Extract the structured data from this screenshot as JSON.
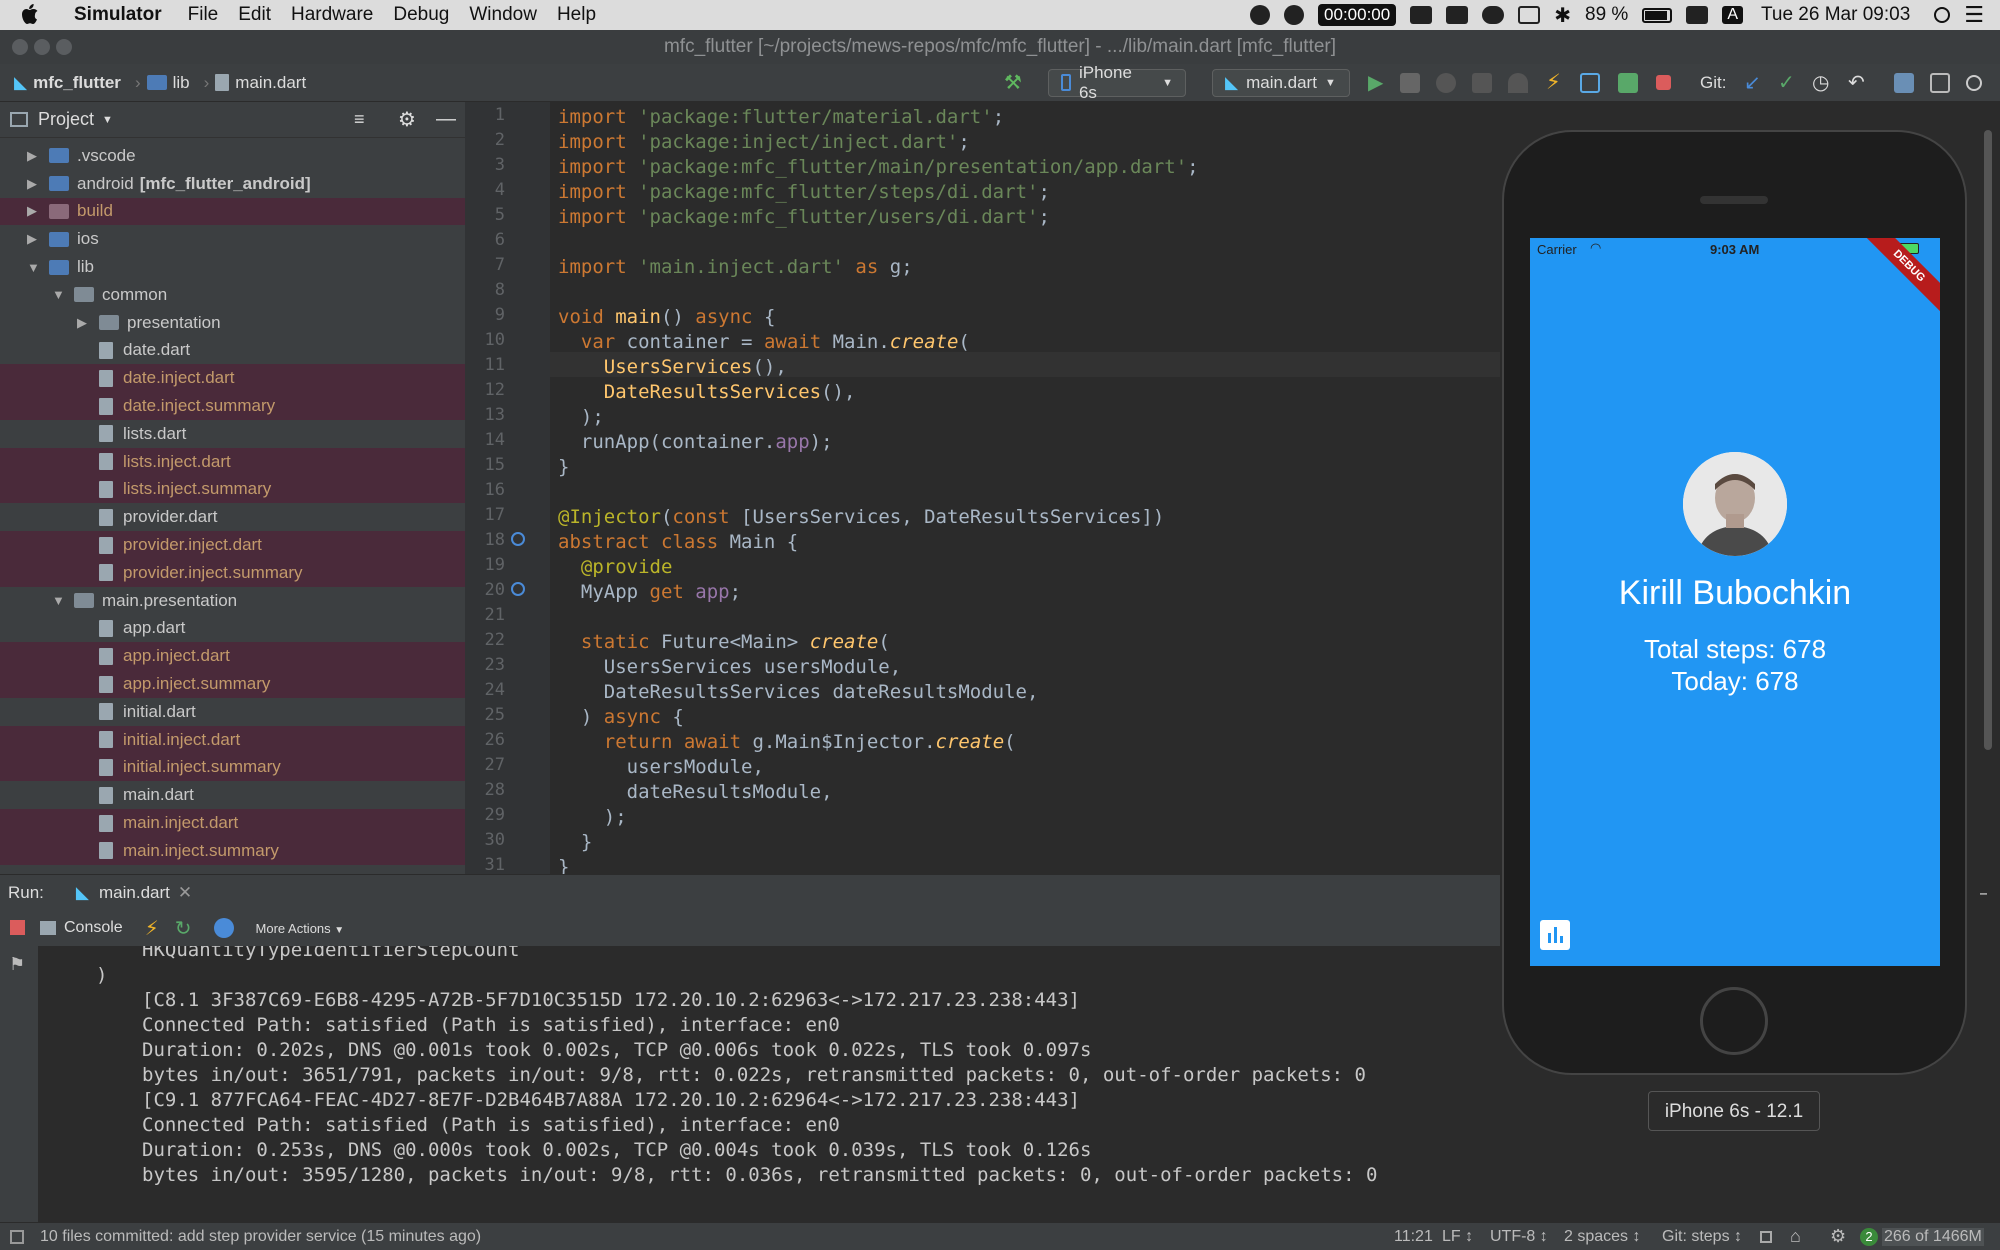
{
  "menubar": {
    "app": "Simulator",
    "items": [
      "File",
      "Edit",
      "Hardware",
      "Debug",
      "Window",
      "Help"
    ],
    "recording": "00:00:00",
    "battery": "89 %",
    "input": "A",
    "datetime": "Tue 26 Mar  09:03"
  },
  "window": {
    "title": "mfc_flutter [~/projects/mews-repos/mfc/mfc_flutter] - .../lib/main.dart [mfc_flutter]"
  },
  "navbar": {
    "crumbs": [
      "mfc_flutter",
      "lib",
      "main.dart"
    ],
    "device": "iPhone 6s",
    "run_config": "main.dart",
    "git_label": "Git:"
  },
  "project": {
    "title": "Project",
    "tree": [
      {
        "label": ".vscode",
        "type": "folder",
        "indent": 1,
        "arrow": "right",
        "ignored": false
      },
      {
        "label": "android",
        "tag": "[mfc_flutter_android]",
        "type": "folder",
        "indent": 1,
        "arrow": "right",
        "ignored": false
      },
      {
        "label": "build",
        "type": "folder",
        "indent": 1,
        "arrow": "right",
        "ignored": true
      },
      {
        "label": "ios",
        "type": "folder",
        "indent": 1,
        "arrow": "right",
        "ignored": false
      },
      {
        "label": "lib",
        "type": "folder",
        "indent": 1,
        "arrow": "down",
        "ignored": false
      },
      {
        "label": "common",
        "type": "folder",
        "indent": 2,
        "arrow": "down",
        "ignored": false
      },
      {
        "label": "presentation",
        "type": "folder",
        "indent": 3,
        "arrow": "right",
        "ignored": false
      },
      {
        "label": "date.dart",
        "type": "file",
        "indent": 3,
        "ignored": false
      },
      {
        "label": "date.inject.dart",
        "type": "file",
        "indent": 3,
        "ignored": true
      },
      {
        "label": "date.inject.summary",
        "type": "file",
        "indent": 3,
        "ignored": true
      },
      {
        "label": "lists.dart",
        "type": "file",
        "indent": 3,
        "ignored": false
      },
      {
        "label": "lists.inject.dart",
        "type": "file",
        "indent": 3,
        "ignored": true
      },
      {
        "label": "lists.inject.summary",
        "type": "file",
        "indent": 3,
        "ignored": true
      },
      {
        "label": "provider.dart",
        "type": "file",
        "indent": 3,
        "ignored": false
      },
      {
        "label": "provider.inject.dart",
        "type": "file",
        "indent": 3,
        "ignored": true
      },
      {
        "label": "provider.inject.summary",
        "type": "file",
        "indent": 3,
        "ignored": true
      },
      {
        "label": "main.presentation",
        "type": "folder",
        "indent": 2,
        "arrow": "down",
        "ignored": false
      },
      {
        "label": "app.dart",
        "type": "file",
        "indent": 3,
        "ignored": false
      },
      {
        "label": "app.inject.dart",
        "type": "file",
        "indent": 3,
        "ignored": true
      },
      {
        "label": "app.inject.summary",
        "type": "file",
        "indent": 3,
        "ignored": true
      },
      {
        "label": "initial.dart",
        "type": "file",
        "indent": 3,
        "ignored": false
      },
      {
        "label": "initial.inject.dart",
        "type": "file",
        "indent": 3,
        "ignored": true
      },
      {
        "label": "initial.inject.summary",
        "type": "file",
        "indent": 3,
        "ignored": true
      },
      {
        "label": "main.dart",
        "type": "file",
        "indent": 3,
        "ignored": false
      },
      {
        "label": "main.inject.dart",
        "type": "file",
        "indent": 3,
        "ignored": true
      },
      {
        "label": "main.inject.summary",
        "type": "file",
        "indent": 3,
        "ignored": true
      }
    ]
  },
  "editor": {
    "lines": [
      [
        [
          "kw",
          "import "
        ],
        [
          "str",
          "'package:flutter/material.dart'"
        ],
        [
          "",
          "; "
        ]
      ],
      [
        [
          "kw",
          "import "
        ],
        [
          "str",
          "'package:inject/inject.dart'"
        ],
        [
          "",
          ";"
        ]
      ],
      [
        [
          "kw",
          "import "
        ],
        [
          "str",
          "'package:mfc_flutter/main/presentation/app.dart'"
        ],
        [
          "",
          ";"
        ]
      ],
      [
        [
          "kw",
          "import "
        ],
        [
          "str",
          "'package:mfc_flutter/steps/di.dart'"
        ],
        [
          "",
          ";"
        ]
      ],
      [
        [
          "kw",
          "import "
        ],
        [
          "str",
          "'package:mfc_flutter/users/di.dart'"
        ],
        [
          "",
          ";"
        ]
      ],
      [],
      [
        [
          "kw",
          "import "
        ],
        [
          "str",
          "'main.inject.dart' "
        ],
        [
          "kw",
          "as "
        ],
        [
          "",
          "g;"
        ]
      ],
      [],
      [
        [
          "kw",
          "void "
        ],
        [
          "fn",
          "main"
        ],
        [
          "",
          "() "
        ],
        [
          "kw",
          "async "
        ],
        [
          "",
          "{"
        ]
      ],
      [
        [
          "",
          "  "
        ],
        [
          "kw",
          "var "
        ],
        [
          "",
          "container = "
        ],
        [
          "kw",
          "await "
        ],
        [
          "",
          "Main."
        ],
        [
          "it",
          "create"
        ],
        [
          "",
          "("
        ]
      ],
      [
        [
          "",
          "    "
        ],
        [
          "fn",
          "UsersServices"
        ],
        [
          "",
          "(),"
        ]
      ],
      [
        [
          "",
          "    "
        ],
        [
          "fn",
          "DateResultsServices"
        ],
        [
          "",
          "(),"
        ]
      ],
      [
        [
          "",
          "  );"
        ]
      ],
      [
        [
          "",
          "  runApp(container."
        ],
        [
          "prop",
          "app"
        ],
        [
          "",
          ");"
        ]
      ],
      [
        [
          "",
          "}"
        ]
      ],
      [],
      [
        [
          "ann",
          "@Injector"
        ],
        [
          "",
          "("
        ],
        [
          "kw",
          "const "
        ],
        [
          "",
          "[UsersServices, DateResultsServices])"
        ]
      ],
      [
        [
          "kw",
          "abstract class "
        ],
        [
          "",
          "Main {"
        ]
      ],
      [
        [
          "",
          "  "
        ],
        [
          "ann",
          "@provide"
        ]
      ],
      [
        [
          "",
          "  MyApp "
        ],
        [
          "kw",
          "get "
        ],
        [
          "prop",
          "app"
        ],
        [
          "",
          ";"
        ]
      ],
      [],
      [
        [
          "",
          "  "
        ],
        [
          "kw",
          "static "
        ],
        [
          "",
          "Future<Main> "
        ],
        [
          "it",
          "create"
        ],
        [
          "",
          "("
        ]
      ],
      [
        [
          "",
          "    UsersServices usersModule,"
        ]
      ],
      [
        [
          "",
          "    DateResultsServices dateResultsModule,"
        ]
      ],
      [
        [
          "",
          "  ) "
        ],
        [
          "kw",
          "async "
        ],
        [
          "",
          "{"
        ]
      ],
      [
        [
          "",
          "    "
        ],
        [
          "kw",
          "return await "
        ],
        [
          "",
          "g.Main$Injector."
        ],
        [
          "it",
          "create"
        ],
        [
          "",
          "("
        ]
      ],
      [
        [
          "",
          "      usersModule,"
        ]
      ],
      [
        [
          "",
          "      dateResultsModule,"
        ]
      ],
      [
        [
          "",
          "    );"
        ]
      ],
      [
        [
          "",
          "  }"
        ]
      ],
      [
        [
          "",
          "}"
        ]
      ]
    ]
  },
  "run": {
    "label": "Run:",
    "tab": "main.dart",
    "console_tab": "Console",
    "more_actions": "More Actions",
    "lines": [
      "HKQuantityTypeIdentifierStepCount",
      ")",
      "[C8.1 3F387C69-E6B8-4295-A72B-5F7D10C3515D 172.20.10.2:62963<->172.217.23.238:443]",
      "Connected Path: satisfied (Path is satisfied), interface: en0",
      "Duration: 0.202s, DNS @0.001s took 0.002s, TCP @0.006s took 0.022s, TLS took 0.097s",
      "bytes in/out: 3651/791, packets in/out: 9/8, rtt: 0.022s, retransmitted packets: 0, out-of-order packets: 0",
      "[C9.1 877FCA64-FEAC-4D27-8E7F-D2B464B7A88A 172.20.10.2:62964<->172.217.23.238:443]",
      "Connected Path: satisfied (Path is satisfied), interface: en0",
      "Duration: 0.253s, DNS @0.000s took 0.002s, TCP @0.004s took 0.039s, TLS took 0.126s",
      "bytes in/out: 3595/1280, packets in/out: 9/8, rtt: 0.036s, retransmitted packets: 0, out-of-order packets: 0"
    ]
  },
  "status": {
    "message": "10 files committed: add step provider service (15 minutes ago)",
    "position": "11:21",
    "line_sep": "LF ↕",
    "encoding": "UTF-8 ↕",
    "indent": "2 spaces ↕",
    "git": "Git: steps ↕",
    "badge": "2",
    "memory": "266 of 1466M"
  },
  "phone": {
    "carrier": "Carrier",
    "time": "9:03 AM",
    "banner": "DEBUG",
    "name": "Kirill Bubochkin",
    "total_steps": "Total steps: 678",
    "today": "Today: 678",
    "device_label": "iPhone 6s - 12.1"
  }
}
